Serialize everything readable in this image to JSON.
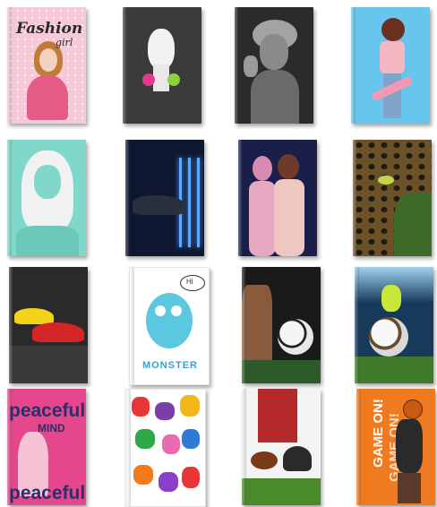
{
  "covers": [
    {
      "id": "fashion-girl",
      "texts": {
        "line1": "Fashion",
        "line2": "girl"
      }
    },
    {
      "id": "giraffe-headphones",
      "texts": {}
    },
    {
      "id": "einstein",
      "texts": {}
    },
    {
      "id": "skater-girl",
      "texts": {}
    },
    {
      "id": "mint-hair-girl",
      "texts": {}
    },
    {
      "id": "neon-car",
      "texts": {}
    },
    {
      "id": "two-girls",
      "texts": {}
    },
    {
      "id": "leopard",
      "texts": {}
    },
    {
      "id": "sports-cars",
      "texts": {}
    },
    {
      "id": "monster",
      "texts": {
        "speech": "Hi",
        "title": "MONSTER"
      }
    },
    {
      "id": "soccer-ball-dark",
      "texts": {}
    },
    {
      "id": "soccer-ball-stadium",
      "texts": {}
    },
    {
      "id": "peaceful-mind",
      "texts": {
        "line1": "peaceful",
        "line2": "MIND",
        "line3": "peaceful"
      }
    },
    {
      "id": "hand-prints",
      "texts": {}
    },
    {
      "id": "american-football",
      "texts": {}
    },
    {
      "id": "game-on",
      "texts": {
        "line1": "GAME ON!",
        "line2": "GAME ON!"
      }
    }
  ],
  "colors": {
    "pink": "#f7c9d6",
    "charcoal": "#3b3b3d",
    "sky": "#68c6ee",
    "mint": "#7fd8c9",
    "navy": "#1c2a4a",
    "magenta": "#e4478c",
    "orange": "#f07a1f"
  }
}
